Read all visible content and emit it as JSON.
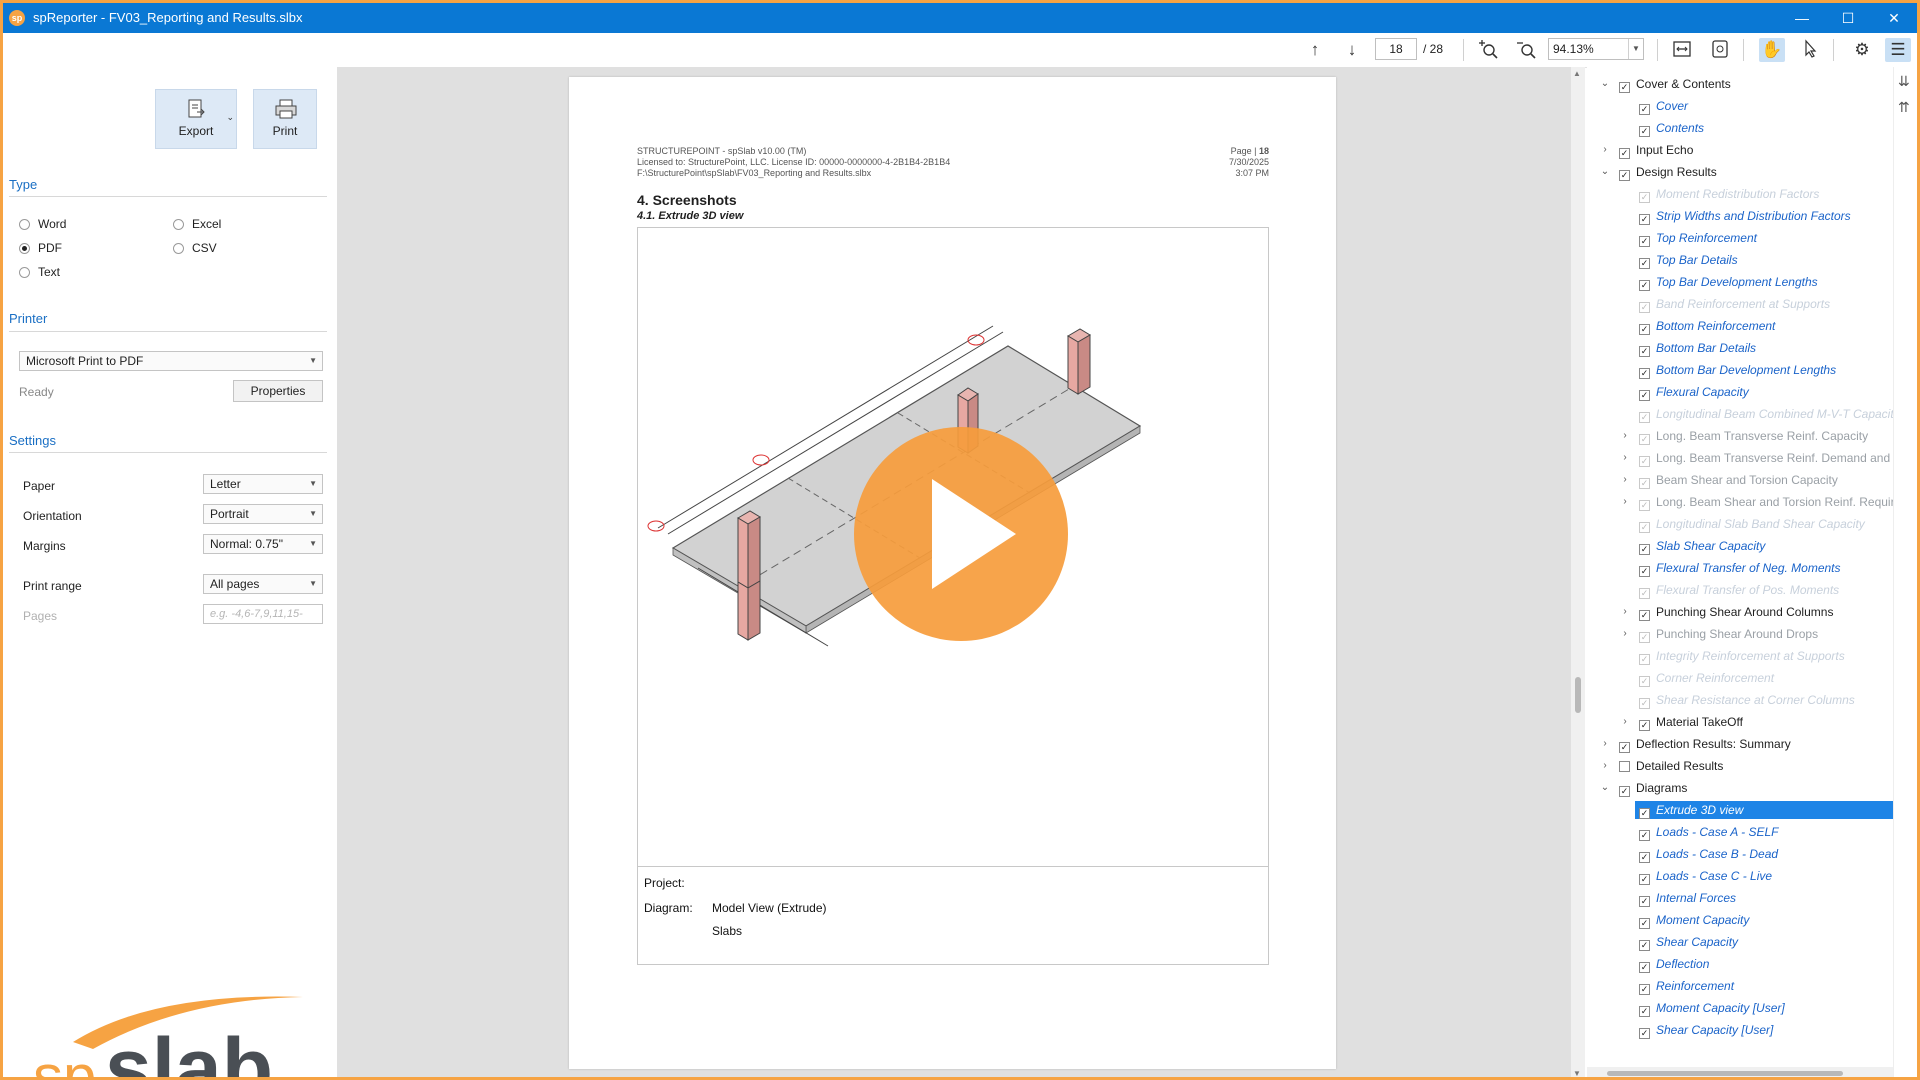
{
  "window": {
    "title": "spReporter - FV03_Reporting and Results.slbx",
    "logo_text": "sp",
    "minimize": "—",
    "maximize": "☐",
    "close": "✕"
  },
  "toolbar": {
    "page_current": "18",
    "page_total": "/ 28",
    "zoom": "94.13%",
    "icons": [
      "arrow-up-icon",
      "arrow-down-icon",
      "zoom-in-icon",
      "zoom-out-icon",
      "fit-width-icon",
      "fit-page-icon",
      "hand-tool-icon",
      "select-tool-icon",
      "settings-icon",
      "checklist-icon"
    ]
  },
  "left": {
    "export_label": "Export",
    "print_label": "Print",
    "type": {
      "heading": "Type",
      "options": {
        "word": "Word",
        "excel": "Excel",
        "pdf": "PDF",
        "csv": "CSV",
        "text": "Text"
      },
      "selected": "PDF"
    },
    "printer": {
      "heading": "Printer",
      "selected": "Microsoft Print to PDF",
      "status": "Ready",
      "properties_label": "Properties"
    },
    "settings": {
      "heading": "Settings",
      "paper_label": "Paper",
      "paper_value": "Letter",
      "orientation_label": "Orientation",
      "orientation_value": "Portrait",
      "margins_label": "Margins",
      "margins_value": "Normal: 0.75\"",
      "range_label": "Print range",
      "range_value": "All pages",
      "pages_label": "Pages",
      "pages_placeholder": "e.g. -4,6-7,9,11,15-"
    },
    "logo": {
      "sp": "sp",
      "slab": "slab"
    }
  },
  "document": {
    "header_left": [
      "STRUCTUREPOINT - spSlab v10.00 (TM)",
      "Licensed to: StructurePoint, LLC. License ID: 00000-0000000-4-2B1B4-2B1B4",
      "F:\\StructurePoint\\spSlab\\FV03_Reporting and Results.slbx"
    ],
    "header_right": {
      "page_label": "Page |",
      "page_number": "18",
      "date": "7/30/2025",
      "time": "3:07 PM"
    },
    "section_title": "4. Screenshots",
    "subsection_title": "4.1. Extrude 3D view",
    "caption": {
      "project_label": "Project:",
      "diagram_label": "Diagram:",
      "diagram_value": "Model View (Extrude)",
      "diagram_value2": "Slabs"
    }
  },
  "tree": [
    {
      "label": "Cover & Contents",
      "level": 0,
      "expander": "v",
      "checked": true,
      "style": "top"
    },
    {
      "label": "Cover",
      "level": 1,
      "checked": true,
      "style": "child"
    },
    {
      "label": "Contents",
      "level": 1,
      "checked": true,
      "style": "child"
    },
    {
      "label": "Input Echo",
      "level": 0,
      "expander": ">",
      "checked": true,
      "style": "top"
    },
    {
      "label": "Design Results",
      "level": 0,
      "expander": "v",
      "checked": true,
      "style": "top"
    },
    {
      "label": "Moment Redistribution Factors",
      "level": 1,
      "checked": true,
      "style": "dim"
    },
    {
      "label": "Strip Widths and Distribution Factors",
      "level": 1,
      "checked": true,
      "style": "child"
    },
    {
      "label": "Top Reinforcement",
      "level": 1,
      "checked": true,
      "style": "child"
    },
    {
      "label": "Top Bar Details",
      "level": 1,
      "checked": true,
      "style": "child"
    },
    {
      "label": "Top Bar Development Lengths",
      "level": 1,
      "checked": true,
      "style": "child"
    },
    {
      "label": "Band Reinforcement at Supports",
      "level": 1,
      "checked": true,
      "style": "dim"
    },
    {
      "label": "Bottom Reinforcement",
      "level": 1,
      "checked": true,
      "style": "child"
    },
    {
      "label": "Bottom Bar Details",
      "level": 1,
      "checked": true,
      "style": "child"
    },
    {
      "label": "Bottom Bar Development Lengths",
      "level": 1,
      "checked": true,
      "style": "child"
    },
    {
      "label": "Flexural Capacity",
      "level": 1,
      "checked": true,
      "style": "child"
    },
    {
      "label": "Longitudinal Beam Combined M-V-T Capacity",
      "level": 1,
      "checked": true,
      "style": "dim"
    },
    {
      "label": "Long. Beam Transverse Reinf. Capacity",
      "level": 1,
      "expander": ">",
      "checked": true,
      "style": "gray"
    },
    {
      "label": "Long. Beam Transverse Reinf. Demand and C",
      "level": 1,
      "expander": ">",
      "checked": true,
      "style": "gray"
    },
    {
      "label": "Beam Shear and Torsion Capacity",
      "level": 1,
      "expander": ">",
      "checked": true,
      "style": "gray"
    },
    {
      "label": "Long. Beam Shear and Torsion Reinf. Requir",
      "level": 1,
      "expander": ">",
      "checked": true,
      "style": "gray"
    },
    {
      "label": "Longitudinal Slab Band Shear Capacity",
      "level": 1,
      "checked": true,
      "style": "dim"
    },
    {
      "label": "Slab Shear Capacity",
      "level": 1,
      "checked": true,
      "style": "child"
    },
    {
      "label": "Flexural Transfer of Neg. Moments",
      "level": 1,
      "checked": true,
      "style": "child"
    },
    {
      "label": "Flexural Transfer of Pos. Moments",
      "level": 1,
      "checked": true,
      "style": "dim"
    },
    {
      "label": "Punching Shear Around Columns",
      "level": 1,
      "expander": ">",
      "checked": true,
      "style": "top"
    },
    {
      "label": "Punching Shear Around Drops",
      "level": 1,
      "expander": ">",
      "checked": true,
      "style": "gray"
    },
    {
      "label": "Integrity Reinforcement at Supports",
      "level": 1,
      "checked": true,
      "style": "dim"
    },
    {
      "label": "Corner Reinforcement",
      "level": 1,
      "checked": true,
      "style": "dim"
    },
    {
      "label": "Shear Resistance at Corner Columns",
      "level": 1,
      "checked": true,
      "style": "dim"
    },
    {
      "label": "Material TakeOff",
      "level": 1,
      "expander": ">",
      "checked": true,
      "style": "top"
    },
    {
      "label": "Deflection Results: Summary",
      "level": 0,
      "expander": ">",
      "checked": true,
      "style": "top"
    },
    {
      "label": "Detailed Results",
      "level": 0,
      "expander": ">",
      "checked": false,
      "style": "top"
    },
    {
      "label": "Diagrams",
      "level": 0,
      "expander": "v",
      "checked": true,
      "style": "top"
    },
    {
      "label": "Extrude 3D view",
      "level": 1,
      "checked": true,
      "style": "sel"
    },
    {
      "label": "Loads - Case A - SELF",
      "level": 1,
      "checked": true,
      "style": "child"
    },
    {
      "label": "Loads - Case B - Dead",
      "level": 1,
      "checked": true,
      "style": "child"
    },
    {
      "label": "Loads - Case C - Live",
      "level": 1,
      "checked": true,
      "style": "child"
    },
    {
      "label": "Internal Forces",
      "level": 1,
      "checked": true,
      "style": "child"
    },
    {
      "label": "Moment Capacity",
      "level": 1,
      "checked": true,
      "style": "child"
    },
    {
      "label": "Shear Capacity",
      "level": 1,
      "checked": true,
      "style": "child"
    },
    {
      "label": "Deflection",
      "level": 1,
      "checked": true,
      "style": "child"
    },
    {
      "label": "Reinforcement",
      "level": 1,
      "checked": true,
      "style": "child"
    },
    {
      "label": "Moment Capacity [User]",
      "level": 1,
      "checked": true,
      "style": "child"
    },
    {
      "label": "Shear Capacity [User]",
      "level": 1,
      "checked": true,
      "style": "child"
    }
  ],
  "colors": {
    "accent": "#0a78d4",
    "border": "#f6a343",
    "play": "#f69c3c",
    "tree_link": "#1a63c9"
  }
}
